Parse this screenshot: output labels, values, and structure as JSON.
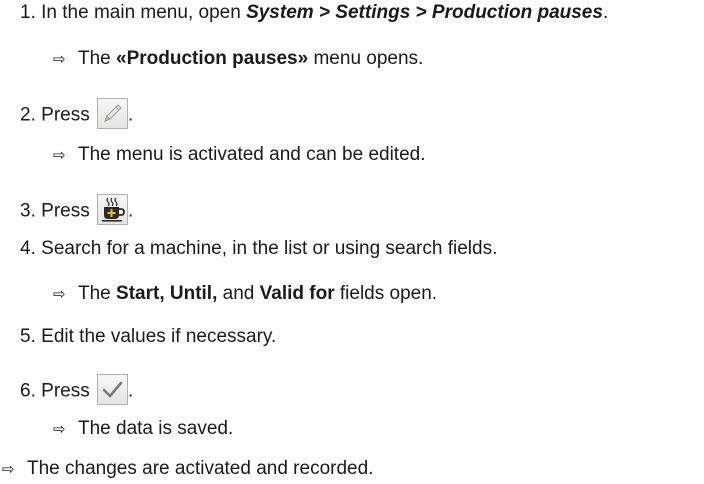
{
  "steps": [
    {
      "number": "1.",
      "text_before": "In the main menu, open ",
      "path": "System > Settings > Production pauses",
      "text_after": ".",
      "result": {
        "text_before": "The ",
        "bold": "«Production pauses»",
        "text_after": " menu opens."
      }
    },
    {
      "number": "2.",
      "text": "Press",
      "icon": "edit-pencil-icon",
      "text_after": ".",
      "result": {
        "text": "The menu is activated and can be edited."
      }
    },
    {
      "number": "3.",
      "text": "Press",
      "icon": "add-pause-coffee-icon",
      "text_after": "."
    },
    {
      "number": "4.",
      "text": "Search for a machine, in the list or using search fields.",
      "result": {
        "text_before": "The ",
        "bold1": "Start, Until,",
        "mid": " and ",
        "bold2": "Valid for",
        "text_after": " fields open."
      }
    },
    {
      "number": "5.",
      "text": "Edit the values if necessary."
    },
    {
      "number": "6.",
      "text": "Press",
      "icon": "confirm-checkmark-icon",
      "text_after": ".",
      "result": {
        "text": "The data is saved."
      }
    }
  ],
  "final_result": "The changes are activated and recorded.",
  "arrow_glyph": "⇨",
  "colors": {
    "text": "#1a1a1a",
    "icon_border": "#b0b0b0",
    "cup": "#2a2a2a",
    "cup_plus": "#f2c200",
    "check": "#7a7a7a"
  }
}
